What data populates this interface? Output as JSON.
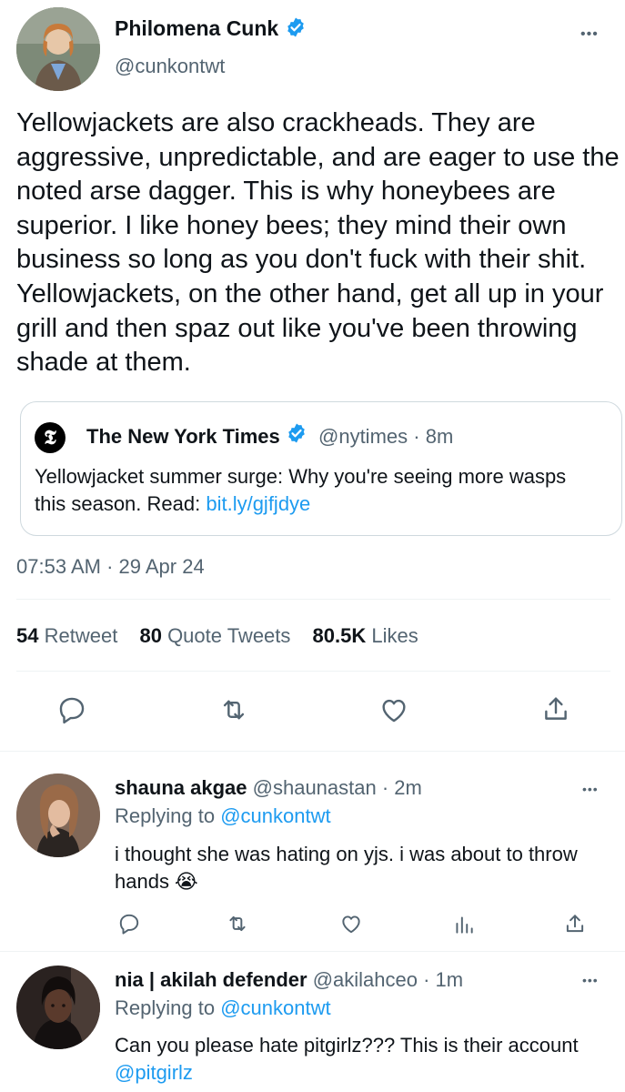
{
  "tweet": {
    "author_name": "Philomena Cunk",
    "author_handle": "@cunkontwt",
    "more_label": "•••",
    "text": "Yellowjackets are also crackheads. They are aggressive, unpredictable, and are eager to use the noted arse dagger. This is why honeybees are superior. I like honey bees; they mind their own business so long as you don't fuck with their shit. Yellowjackets, on the other hand, get all up in your grill and then spaz out like you've been throwing shade at them.",
    "quote": {
      "source_name": "The New York Times",
      "source_handle": "@nytimes",
      "time": "· 8m",
      "text": "Yellowjacket summer surge: Why you're seeing more wasps this season. Read: ",
      "link": "bit.ly/gjfjdye"
    },
    "timestamp": "07:53 AM · 29 Apr 24",
    "stats": {
      "retweets_count": "54",
      "retweets_label": "Retweet",
      "quotes_count": "80",
      "quotes_label": "Quote Tweets",
      "likes_count": "80.5K",
      "likes_label": "Likes"
    }
  },
  "replies": [
    {
      "author_name": "shauna akgae",
      "author_handle": "@shaunastan",
      "time": "· 2m",
      "replying_prefix": "Replying to ",
      "replying_handle": "@cunkontwt",
      "text": "i thought she was hating on yjs. i was about to throw hands 😭",
      "more_label": "•••"
    },
    {
      "author_name": "nia | akilah defender",
      "author_handle": "@akilahceo",
      "time": "· 1m",
      "replying_prefix": "Replying to ",
      "replying_handle": "@cunkontwt",
      "text_before": "Can you please hate pitgirlz??? This is their account ",
      "mention": "@pitgirlz",
      "more_label": "•••"
    }
  ],
  "colors": {
    "accent": "#1d9bf0",
    "muted": "#536471",
    "text": "#0f1419",
    "divider": "#eff3f4"
  }
}
